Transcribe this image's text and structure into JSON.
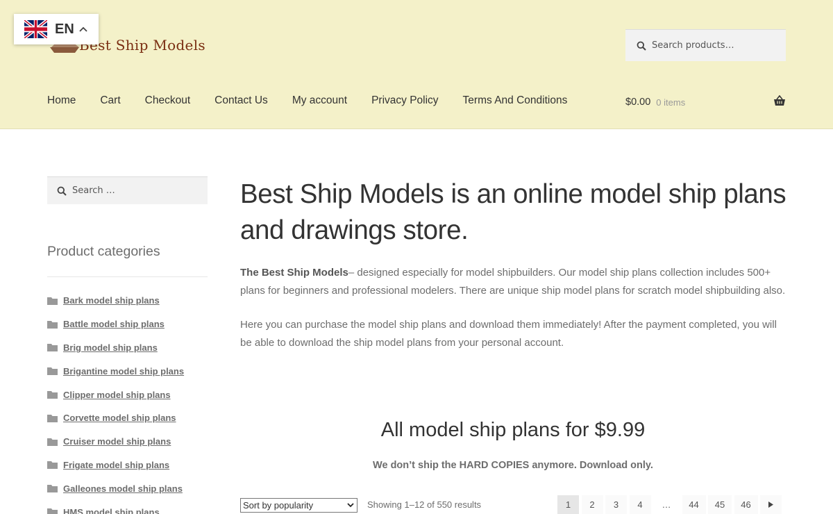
{
  "language": {
    "code": "EN"
  },
  "site": {
    "logo_text": "Best Ship Models"
  },
  "header_search": {
    "placeholder": "Search products…"
  },
  "nav": [
    {
      "label": "Home"
    },
    {
      "label": "Cart"
    },
    {
      "label": "Checkout"
    },
    {
      "label": "Contact Us"
    },
    {
      "label": "My account"
    },
    {
      "label": "Privacy Policy"
    },
    {
      "label": "Terms And Conditions"
    }
  ],
  "cart": {
    "amount": "$0.00",
    "count": "0 items"
  },
  "sidebar": {
    "search_placeholder": "Search …",
    "categories_title": "Product categories",
    "categories": [
      {
        "label": "Bark model ship plans"
      },
      {
        "label": "Battle model ship plans"
      },
      {
        "label": "Brig model ship plans"
      },
      {
        "label": "Brigantine model ship plans"
      },
      {
        "label": "Clipper model ship plans"
      },
      {
        "label": "Corvette model ship plans"
      },
      {
        "label": "Cruiser model ship plans"
      },
      {
        "label": "Frigate model ship plans"
      },
      {
        "label": "Galleones model ship plans"
      },
      {
        "label": "HMS model ship plans"
      }
    ]
  },
  "main": {
    "headline": "Best Ship Models is an online model ship plans and drawings store.",
    "intro_bold": "The Best Ship Models",
    "intro_rest": "– designed especially for model shipbuilders. Our model ship plans collection includes 500+ plans for beginners and professional modelers. There are unique ship model plans for scratch model shipbuilding also.",
    "para2": "Here you can purchase the model ship plans and download them immediately! After the payment completed, you will be able to download the ship model plans from your personal account.",
    "promo_title": "All model ship plans for $9.99",
    "promo_note": "We don’t ship the HARD COPIES anymore. Download only."
  },
  "shop": {
    "sort_label": "Sort by popularity",
    "result_count": "Showing 1–12 of 550 results",
    "pages": [
      "1",
      "2",
      "3",
      "4",
      "…",
      "44",
      "45",
      "46"
    ]
  },
  "colors": {
    "header_bg": "#f4f1c9",
    "logo": "#7a2e12",
    "text": "#6d6d6d",
    "heading": "#333333"
  },
  "icons": [
    "uk-flag-icon",
    "chevron-up-icon",
    "ship-logo-icon",
    "search-icon",
    "basket-icon",
    "folder-icon",
    "dropdown-arrow-icon",
    "next-arrow-icon"
  ]
}
